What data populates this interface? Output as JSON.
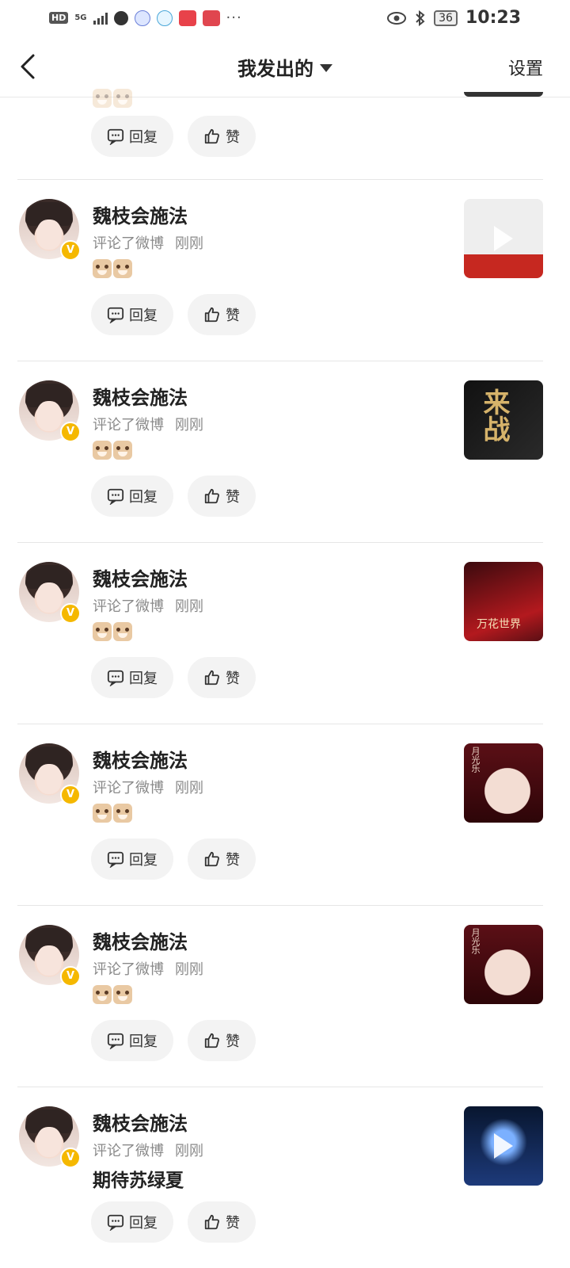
{
  "status_bar": {
    "hd": "HD",
    "network": "5G",
    "dots": "···",
    "battery": "36",
    "time": "10:23"
  },
  "nav": {
    "back_icon": "chevron-left-icon",
    "title": "我发出的",
    "settings_label": "设置"
  },
  "actions": {
    "reply_label": "回复",
    "like_label": "赞"
  },
  "items": [
    {
      "name": "魏枝会施法",
      "action": "评论了微博",
      "time": "刚刚",
      "content_type": "emoji"
    },
    {
      "name": "魏枝会施法",
      "action": "评论了微博",
      "time": "刚刚",
      "content_type": "emoji"
    },
    {
      "name": "魏枝会施法",
      "action": "评论了微博",
      "time": "刚刚",
      "content_type": "emoji",
      "thumb_text": "万花世界"
    },
    {
      "name": "魏枝会施法",
      "action": "评论了微博",
      "time": "刚刚",
      "content_type": "emoji",
      "thumb_text": "月光乐"
    },
    {
      "name": "魏枝会施法",
      "action": "评论了微博",
      "time": "刚刚",
      "content_type": "emoji",
      "thumb_text": "月光乐"
    },
    {
      "name": "魏枝会施法",
      "action": "评论了微博",
      "time": "刚刚",
      "content_type": "text",
      "text": "期待苏绿夏"
    }
  ],
  "thumb2_text": "来战",
  "colors": {
    "verified": "#f5b800",
    "divider": "#e6e6e6",
    "button_bg": "#f3f3f3"
  }
}
